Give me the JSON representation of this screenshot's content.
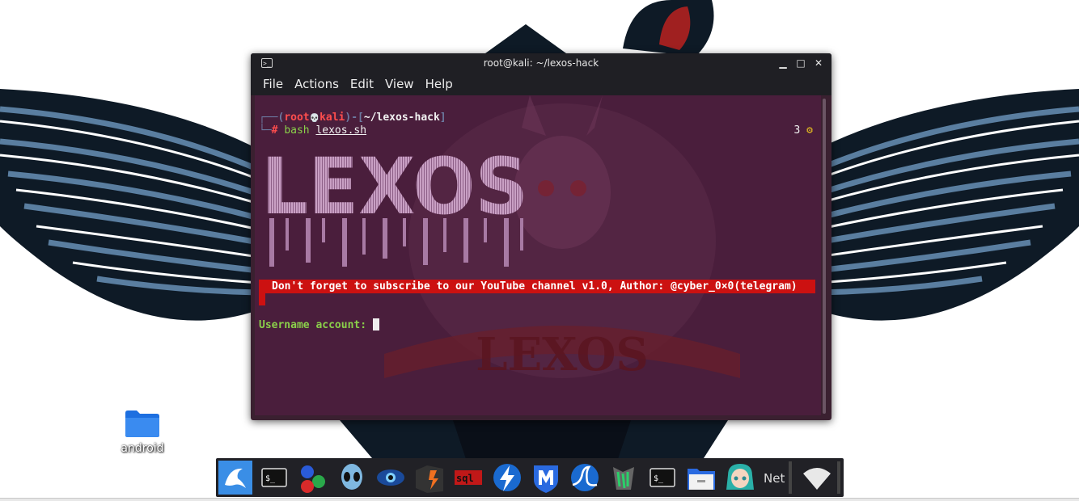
{
  "desktop": {
    "icons": [
      {
        "label": "android",
        "icon": "folder-icon"
      }
    ]
  },
  "window": {
    "title": "root@kali: ~/lexos-hack",
    "menu": [
      "File",
      "Actions",
      "Edit",
      "View",
      "Help"
    ]
  },
  "terminal": {
    "prompt_open": "┌──(",
    "prompt_user": "root",
    "prompt_skull": "💀",
    "prompt_host": "kali",
    "prompt_mid": ")-[",
    "prompt_path": "~/lexos-hack",
    "prompt_close": "]",
    "prompt_line2": "└─",
    "prompt_hash": "#",
    "command": "bash",
    "command_arg": "lexos.sh",
    "jobs_count": "3",
    "jobs_icon": "⚙",
    "logo_text": "LEXOS",
    "banner": "Don't forget to subscribe to our YouTube channel v1.0, Author: @cyber_0×0(telegram)",
    "input_label": "Username account:"
  },
  "taskbar": {
    "items": [
      "kali-dragon-icon",
      "terminal-icon",
      "app-circles-icon",
      "alien-icon",
      "eye-icon",
      "burp-icon",
      "sqlmap-icon",
      "zap-icon",
      "metasploit-icon",
      "wireshark-icon",
      "beef-icon",
      "terminal-icon-2",
      "file-manager-icon",
      "anime-avatar-icon"
    ],
    "net_label": "Net"
  },
  "colors": {
    "terminal_bg": "#4a1e3c",
    "banner_bg": "#cc1111",
    "prompt_red": "#ff4d4d",
    "prompt_green": "#8ad04a",
    "titlebar": "#1f1f24"
  }
}
